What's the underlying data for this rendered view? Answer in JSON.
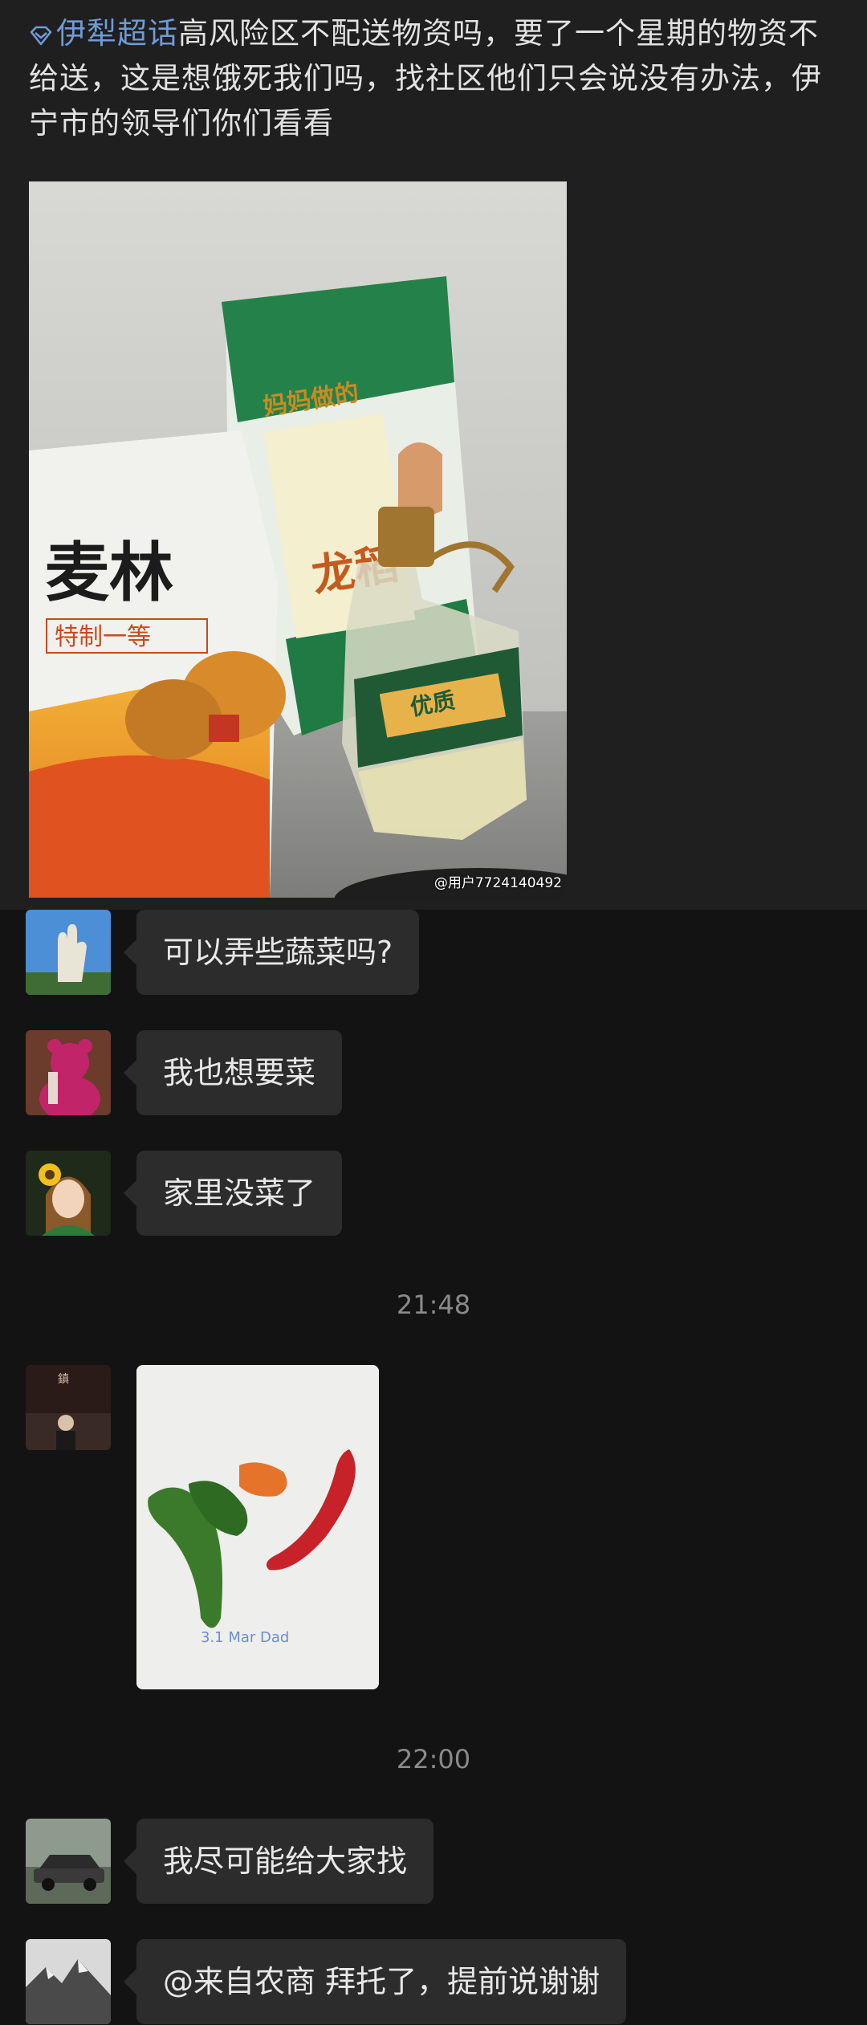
{
  "post": {
    "topic": "伊犁超话",
    "text": "高风险区不配送物资吗，要了一个星期的物资不给送，这是想饿死我们吗，找社区他们只会说没有办法，伊宁市的领导们你们看看",
    "image_watermark": "@用户7724140492",
    "bag_flour_brand": "麦林",
    "bag_flour_sub": "特制一等",
    "bag_rice_brand": "龙稻",
    "bag_rice_tag": "妈妈做的",
    "oil_label": "优质"
  },
  "messages": [
    {
      "text": "可以弄些蔬菜吗?",
      "avatar": "hand-statue-avatar"
    },
    {
      "text": "我也想要菜",
      "avatar": "pink-bear-avatar"
    },
    {
      "text": "家里没菜了",
      "avatar": "sunflower-girl-avatar"
    }
  ],
  "time_1": "21:48",
  "image_message_caption": "3.1 Mar Dad",
  "time_2": "22:00",
  "messages_2": [
    {
      "text": "我尽可能给大家找",
      "avatar": "car-avatar"
    },
    {
      "text": "@来自农商 拜托了，提前说谢谢",
      "avatar": "mountain-avatar"
    }
  ],
  "colors": {
    "background": "#131313",
    "post_bg": "#1f1f1f",
    "bubble": "#2c2c2c",
    "topic_link": "#6f9bd6",
    "timestamp": "#8a8a8a"
  }
}
